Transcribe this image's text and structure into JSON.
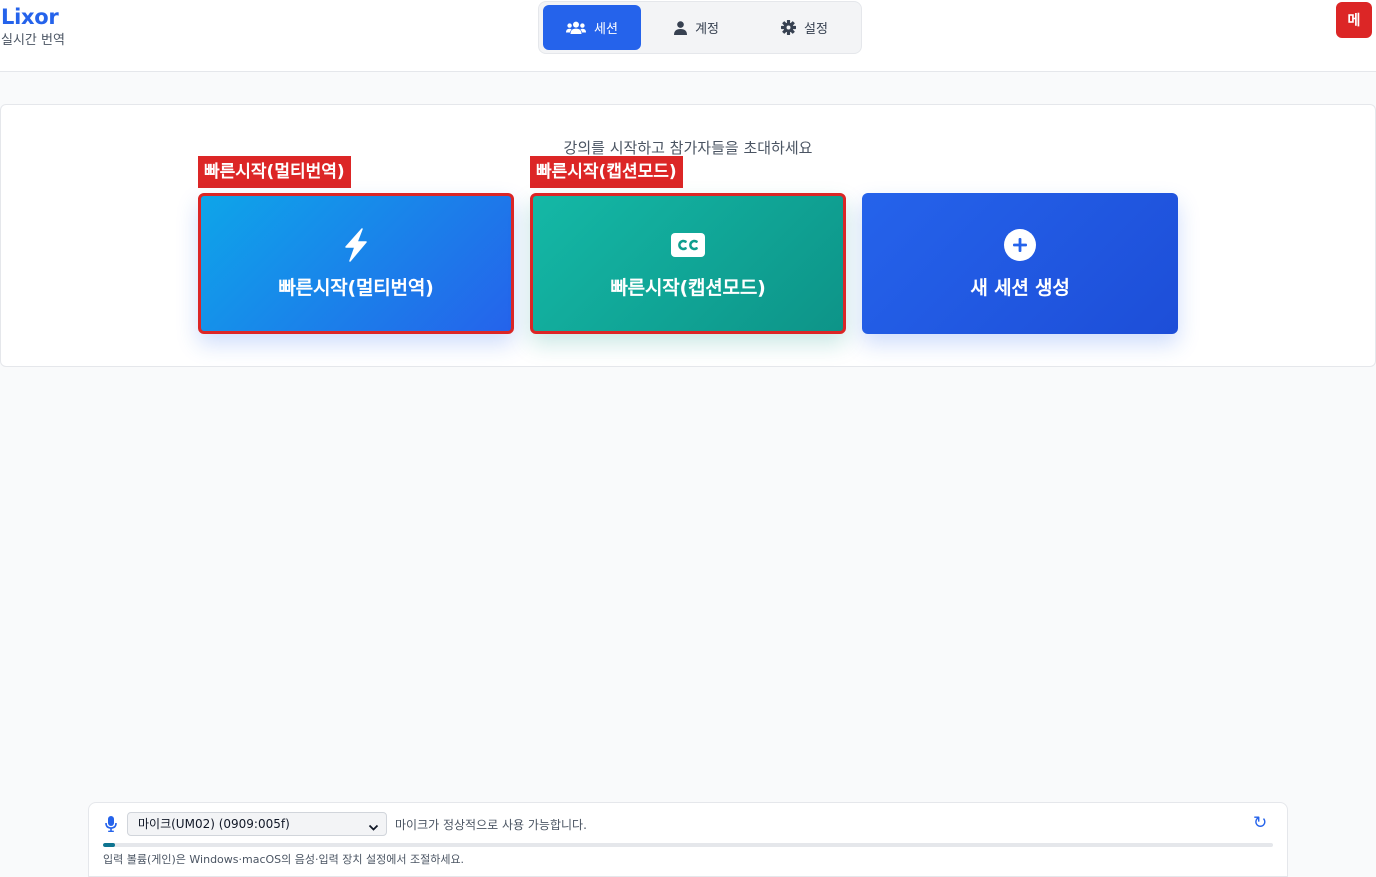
{
  "brand": {
    "name": "Lixor",
    "subtitle": "실시간 번역"
  },
  "tabs": [
    {
      "label": "세션",
      "icon": "users-icon",
      "active": true
    },
    {
      "label": "계정",
      "icon": "user-icon",
      "active": false
    },
    {
      "label": "설정",
      "icon": "gear-icon",
      "active": false
    }
  ],
  "menu_button": {
    "label": "메"
  },
  "main": {
    "subtitle": "강의를 시작하고 참가자들을 초대하세요",
    "annotations": [
      "빠른시작(멀티번역)",
      "빠른시작(캡션모드)"
    ],
    "actions": [
      {
        "label": "빠른시작(멀티번역)",
        "icon": "lightning-icon"
      },
      {
        "label": "빠른시작(캡션모드)",
        "icon": "cc-icon"
      },
      {
        "label": "새 세션 생성",
        "icon": "plus-circle-icon"
      }
    ]
  },
  "mic": {
    "device": "마이크(UM02) (0909:005f)",
    "status": "마이크가 정상적으로 사용 가능합니다.",
    "refresh_icon": "↻",
    "level_fraction": 0.01,
    "note": "입력 볼륨(게인)은 Windows·macOS의 음성·입력 장치 설정에서 조절하세요."
  },
  "colors": {
    "accent": "#2563eb",
    "teal": "#0d9488",
    "annotation": "#dc2626"
  }
}
